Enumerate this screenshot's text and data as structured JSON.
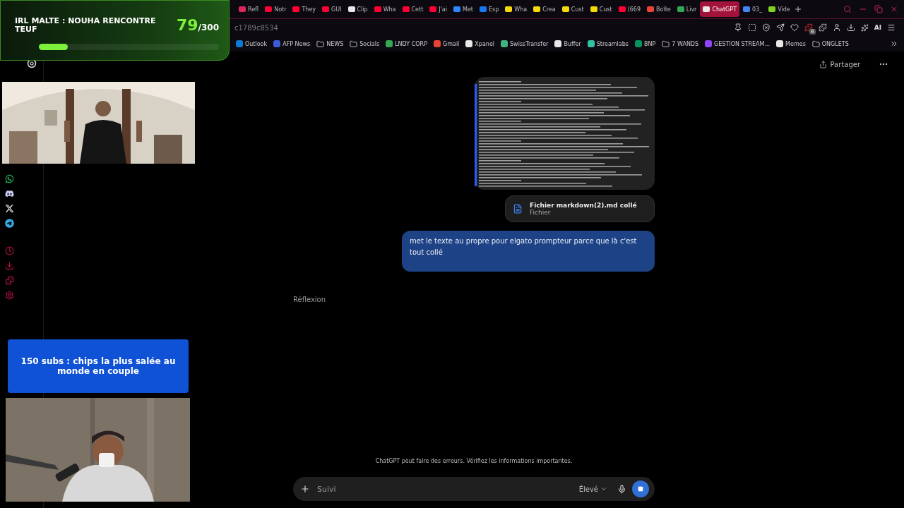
{
  "browser": {
    "tabs": [
      {
        "label": "Refl",
        "color": "#e0245e",
        "selected": false
      },
      {
        "label": "Notr",
        "color": "#ff0033",
        "selected": false
      },
      {
        "label": "They",
        "color": "#ff0033",
        "selected": false
      },
      {
        "label": "GUI",
        "color": "#ff0033",
        "selected": false
      },
      {
        "label": "Clip",
        "color": "#e8e8e8",
        "selected": false
      },
      {
        "label": "Wha",
        "color": "#ff0033",
        "selected": false
      },
      {
        "label": "Cett",
        "color": "#ff0033",
        "selected": false
      },
      {
        "label": "J'ai",
        "color": "#ff0033",
        "selected": false
      },
      {
        "label": "Met",
        "color": "#2d88ff",
        "selected": false
      },
      {
        "label": "Esp",
        "color": "#1877f2",
        "selected": false
      },
      {
        "label": "Wha",
        "color": "#f5d90a",
        "selected": false
      },
      {
        "label": "Crea",
        "color": "#f5d90a",
        "selected": false
      },
      {
        "label": "Cust",
        "color": "#f5d90a",
        "selected": false
      },
      {
        "label": "Cust",
        "color": "#f5d90a",
        "selected": false
      },
      {
        "label": "(669",
        "color": "#ff0033",
        "selected": false
      },
      {
        "label": "Boîte",
        "color": "#ea4335",
        "selected": false
      },
      {
        "label": "Livr",
        "color": "#34a853",
        "selected": false
      },
      {
        "label": "ChatGPT",
        "color": "#e8e8e8",
        "selected": true
      },
      {
        "label": "03_",
        "color": "#4285f4",
        "selected": false
      },
      {
        "label": "Vide",
        "color": "#7ed321",
        "selected": false
      }
    ],
    "address": {
      "url": "c1789c8534"
    },
    "extension_badge": "6",
    "ai_label": "AI",
    "bookmarks": [
      {
        "label": "Outlook",
        "kind": "site",
        "color": "#0f78d4"
      },
      {
        "label": "AFP News",
        "kind": "site",
        "color": "#3b5bdb"
      },
      {
        "label": "NEWS",
        "kind": "folder"
      },
      {
        "label": "Socials",
        "kind": "folder"
      },
      {
        "label": "LNDY CORP",
        "kind": "site",
        "color": "#34a853"
      },
      {
        "label": "Gmail",
        "kind": "site",
        "color": "#ea4335"
      },
      {
        "label": "Xpanel",
        "kind": "site",
        "color": "#e8e8e8"
      },
      {
        "label": "SwissTransfer",
        "kind": "site",
        "color": "#3fb37f"
      },
      {
        "label": "Buffer",
        "kind": "site",
        "color": "#e8e8e8"
      },
      {
        "label": "Streamlabs",
        "kind": "site",
        "color": "#31c3a2"
      },
      {
        "label": "BNP",
        "kind": "site",
        "color": "#00965e"
      },
      {
        "label": "7 WANDS",
        "kind": "folder"
      },
      {
        "label": "GESTION STREAM...",
        "kind": "site",
        "color": "#9146ff"
      },
      {
        "label": "Memes",
        "kind": "site",
        "color": "#e8e8e8"
      },
      {
        "label": "ONGLETS",
        "kind": "folder"
      }
    ]
  },
  "chat": {
    "share_label": "Partager",
    "file": {
      "name": "Fichier markdown(2).md collé",
      "type": "Fichier"
    },
    "user_message": "met le texte au propre pour elgato prompteur parce que là c'est tout collé",
    "status": "Réflexion",
    "disclaimer": "ChatGPT peut faire des erreurs. Vérifiez les informations importantes.",
    "composer": {
      "placeholder": "Suivi",
      "mode": "Élevé"
    }
  },
  "overlay": {
    "title": "IRL MALTE : NOUHA RENCONTRE TEUF",
    "count": "79",
    "goal": "/300",
    "level": 0.16,
    "subs_goal": "150 subs : chips la plus salée au monde en couple"
  }
}
